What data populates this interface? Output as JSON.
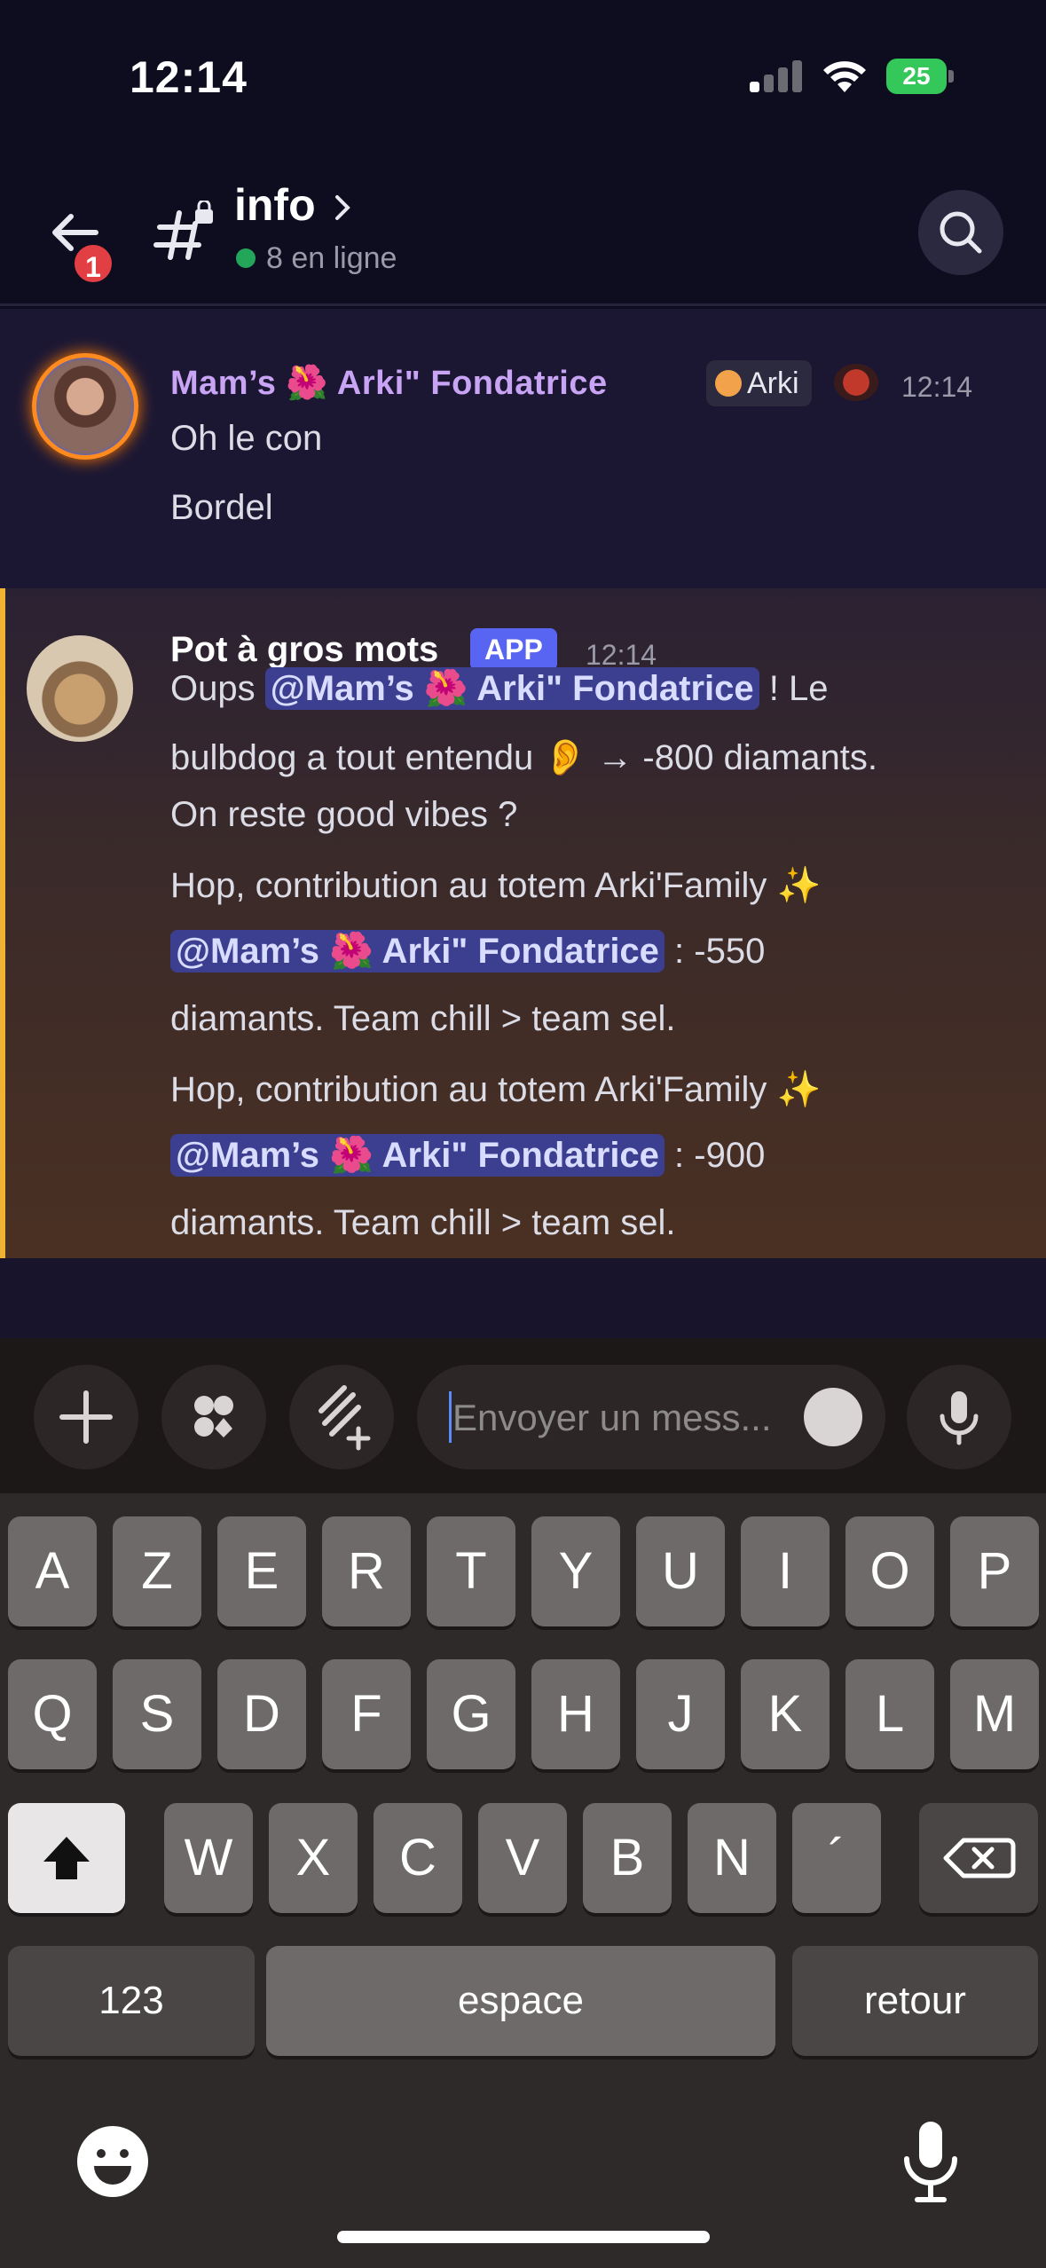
{
  "status_bar": {
    "time": "12:14",
    "battery": "25"
  },
  "header": {
    "back_badge": "1",
    "channel_name": "info",
    "online_text": "8 en ligne"
  },
  "messages": [
    {
      "author": "Mam’s 🌺 Arki\" Fondatrice",
      "tag": "Arki",
      "time": "12:14",
      "lines": [
        "Oh le con",
        "Bordel"
      ]
    },
    {
      "author": "Pot à gros mots",
      "app_label": "APP",
      "time": "12:14",
      "mention": "@Mam’s 🌺 Arki\" Fondatrice",
      "p1_a": "Oups ",
      "p1_b": " ! Le",
      "p1_line2": "bulbdog a tout entendu 👂 → -800 diamants.",
      "p1_line3": "On reste good vibes ?",
      "p2_line1": "Hop, contribution au totem Arki'Family ✨",
      "p2_b": " : -550",
      "p2_line3": "diamants. Team chill > team sel.",
      "p3_line1": "Hop, contribution au totem Arki'Family ✨",
      "p3_b": " : -900",
      "p3_line3": "diamants. Team chill > team sel."
    }
  ],
  "composer": {
    "placeholder": "Envoyer un mess..."
  },
  "keyboard": {
    "row1": [
      "A",
      "Z",
      "E",
      "R",
      "T",
      "Y",
      "U",
      "I",
      "O",
      "P"
    ],
    "row2": [
      "Q",
      "S",
      "D",
      "F",
      "G",
      "H",
      "J",
      "K",
      "L",
      "M"
    ],
    "row3": [
      "W",
      "X",
      "C",
      "V",
      "B",
      "N",
      "´"
    ],
    "numbers": "123",
    "space": "espace",
    "return": "retour"
  }
}
